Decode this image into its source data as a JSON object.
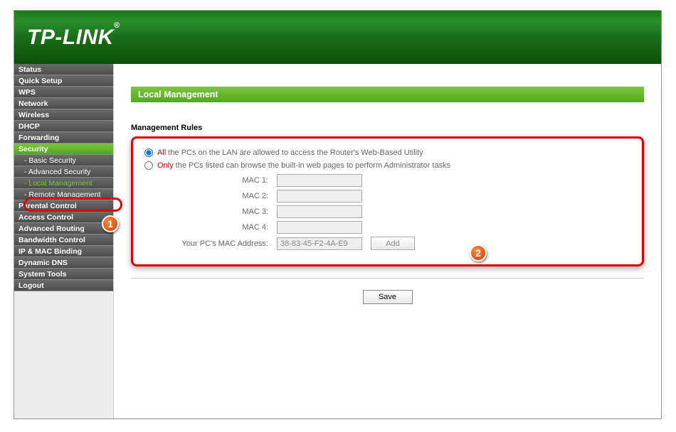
{
  "brand": "TP-LINK",
  "sidebar": {
    "items": [
      {
        "label": "Status",
        "cls": ""
      },
      {
        "label": "Quick Setup",
        "cls": ""
      },
      {
        "label": "WPS",
        "cls": ""
      },
      {
        "label": "Network",
        "cls": ""
      },
      {
        "label": "Wireless",
        "cls": ""
      },
      {
        "label": "DHCP",
        "cls": ""
      },
      {
        "label": "Forwarding",
        "cls": ""
      },
      {
        "label": "Security",
        "cls": "active"
      },
      {
        "label": "- Basic Security",
        "cls": "sidebar-sub"
      },
      {
        "label": "- Advanced Security",
        "cls": "sidebar-sub"
      },
      {
        "label": "- Local Management",
        "cls": "sidebar-sub active-sub"
      },
      {
        "label": "- Remote Management",
        "cls": "sidebar-sub"
      },
      {
        "label": "Parental Control",
        "cls": ""
      },
      {
        "label": "Access Control",
        "cls": ""
      },
      {
        "label": "Advanced Routing",
        "cls": ""
      },
      {
        "label": "Bandwidth Control",
        "cls": ""
      },
      {
        "label": "IP & MAC Binding",
        "cls": ""
      },
      {
        "label": "Dynamic DNS",
        "cls": ""
      },
      {
        "label": "System Tools",
        "cls": ""
      },
      {
        "label": "Logout",
        "cls": ""
      }
    ]
  },
  "page": {
    "title": "Local Management",
    "section": "Management Rules",
    "radio1_hl": "All",
    "radio1_rest": " the PCs on the LAN are allowed to access the Router's Web-Based Utility",
    "radio2_hl": "Only",
    "radio2_rest": " the PCs listed can browse the built-in web pages to perform Administrator tasks",
    "mac1_label": "MAC 1:",
    "mac2_label": "MAC 2:",
    "mac3_label": "MAC 3:",
    "mac4_label": "MAC 4:",
    "yourmac_label": "Your PC's MAC Address:",
    "yourmac_value": "38-83-45-F2-4A-E9",
    "add_label": "Add",
    "save_label": "Save"
  },
  "callouts": {
    "c1": "1",
    "c2": "2"
  }
}
